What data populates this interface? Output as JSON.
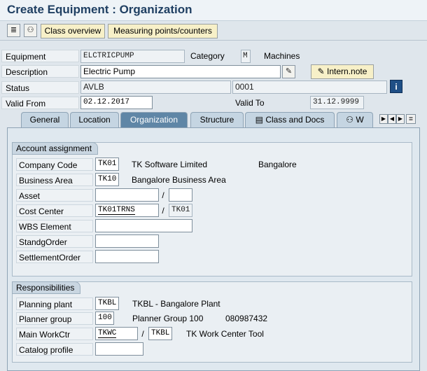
{
  "window": {
    "title": "Create Equipment : Organization"
  },
  "toolbar": {
    "icons": [
      {
        "name": "display-icon",
        "glyph": "≣"
      },
      {
        "name": "hierarchy-icon",
        "glyph": "⚇"
      }
    ],
    "class_overview": "Class overview",
    "measuring_points": "Measuring points/counters"
  },
  "header": {
    "equipment_label": "Equipment",
    "equipment_value": "ELCTRICPUMP",
    "category_label": "Category",
    "category_value": "M",
    "category_text": "Machines",
    "description_label": "Description",
    "description_value": "Electric Pump",
    "intern_note": "Intern.note",
    "status_label": "Status",
    "status_value": "AVLB",
    "status_value2": "0001",
    "valid_from_label": "Valid From",
    "valid_from_value": "02.12.2017",
    "valid_to_label": "Valid To",
    "valid_to_value": "31.12.9999"
  },
  "tabs": [
    {
      "label": "General",
      "active": false
    },
    {
      "label": "Location",
      "active": false
    },
    {
      "label": "Organization",
      "active": true
    },
    {
      "label": "Structure",
      "active": false
    },
    {
      "label": "Class and Docs",
      "active": false
    },
    {
      "label": "W",
      "active": false
    }
  ],
  "account_assignment": {
    "title": "Account assignment",
    "company_code_label": "Company Code",
    "company_code_value": "TK01",
    "company_code_text": "TK Software Limited",
    "company_code_city": "Bangalore",
    "business_area_label": "Business Area",
    "business_area_value": "TK10",
    "business_area_text": "Bangalore Business Area",
    "asset_label": "Asset",
    "asset_value": "",
    "asset_sub_value": "",
    "cost_center_label": "Cost Center",
    "cost_center_value": "TK01TRNS",
    "cost_center_sub_value": "TK01",
    "wbs_label": "WBS Element",
    "wbs_value": "",
    "standg_order_label": "StandgOrder",
    "standg_order_value": "",
    "settlement_order_label": "SettlementOrder",
    "settlement_order_value": ""
  },
  "responsibilities": {
    "title": "Responsibilities",
    "planning_plant_label": "Planning plant",
    "planning_plant_value": "TKBL",
    "planning_plant_text": "TKBL - Bangalore Plant",
    "planner_group_label": "Planner group",
    "planner_group_value": "100",
    "planner_group_text": "Planner Group 100",
    "planner_group_phone": "080987432",
    "main_workctr_label": "Main WorkCtr",
    "main_workctr_value": "TKWC",
    "main_workctr_plant": "TKBL",
    "main_workctr_text": "TK Work Center Tool",
    "catalog_profile_label": "Catalog profile",
    "catalog_profile_value": ""
  },
  "colors": {
    "title": "#1f3f62",
    "button_bg": "#f7f0c8",
    "active_tab": "#5f86a6",
    "tab": "#c5d5e2"
  }
}
